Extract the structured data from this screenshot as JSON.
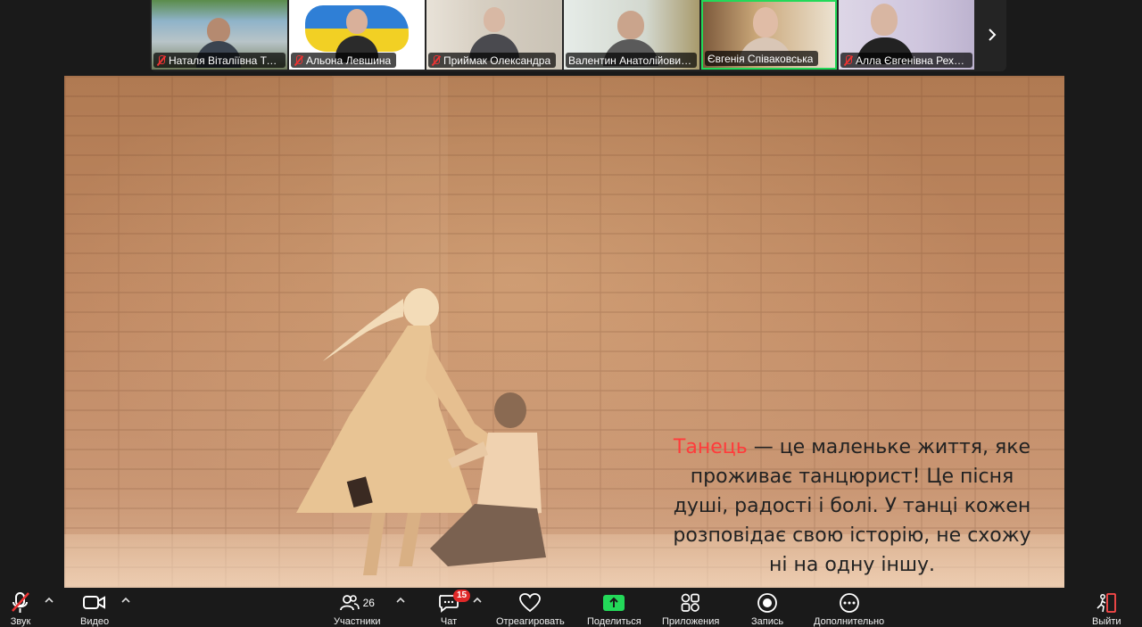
{
  "gallery": {
    "participants": [
      {
        "name": "Наталя Віталіївна Те…",
        "muted": true,
        "active": false
      },
      {
        "name": "Альона Левшина",
        "muted": true,
        "active": false
      },
      {
        "name": "Приймак Олександра",
        "muted": true,
        "active": false
      },
      {
        "name": "Валентин Анатолійови…",
        "muted": false,
        "active": false
      },
      {
        "name": "Євгенія Співаковська",
        "muted": false,
        "active": true
      },
      {
        "name": "Алла Євгенівна Рехл…",
        "muted": true,
        "active": false
      }
    ],
    "next_icon": "chevron-right-icon"
  },
  "share": {
    "caption_accent": "Танець",
    "caption_rest": " — це маленьке життя, яке проживає танцюрист! Це пісня душі, радості і болі.  У танці кожен розповідає свою історію, не схожу ні на одну іншу."
  },
  "toolbar": {
    "audio_label": "Звук",
    "video_label": "Видео",
    "participants_label": "Участники",
    "participants_count": "26",
    "chat_label": "Чат",
    "chat_badge": "15",
    "react_label": "Отреагировать",
    "share_label": "Поделиться",
    "apps_label": "Приложения",
    "record_label": "Запись",
    "more_label": "Дополнительно",
    "leave_label": "Выйти"
  },
  "colors": {
    "active_border": "#23d959",
    "share_green": "#23d959",
    "muted_red": "#e33333",
    "accent_text": "#ff3b3b"
  }
}
